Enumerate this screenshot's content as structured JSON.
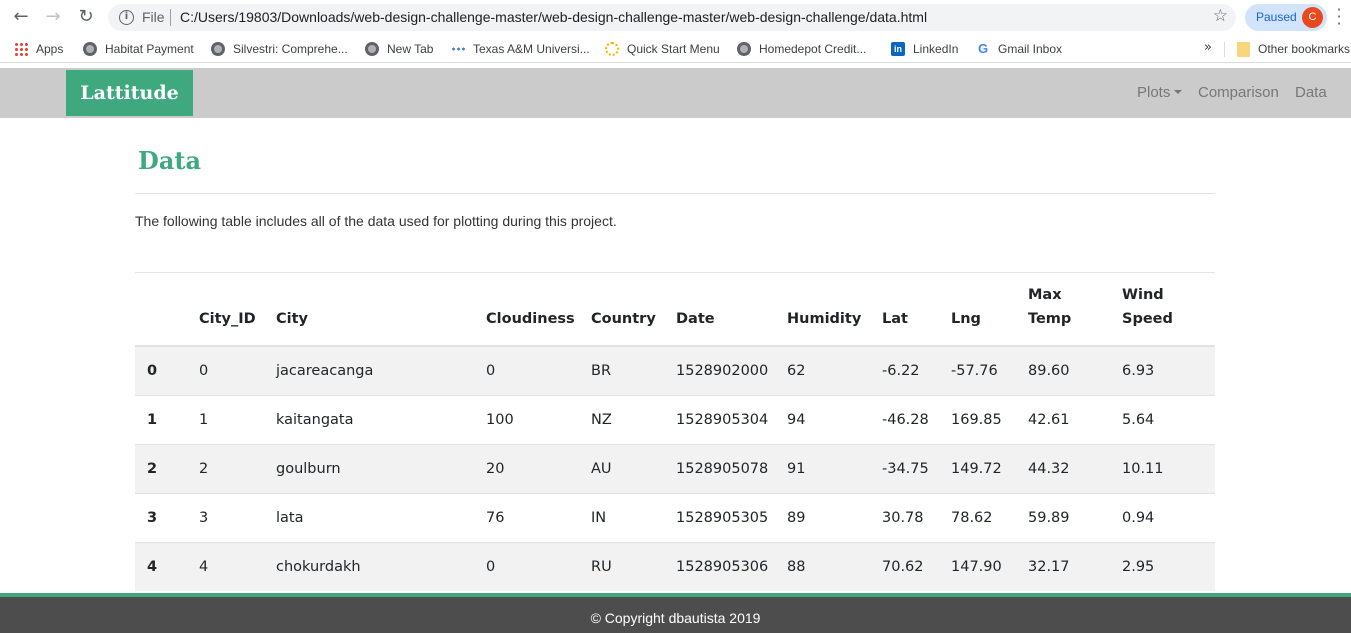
{
  "browser": {
    "file_label": "File",
    "url": "C:/Users/19803/Downloads/web-design-challenge-master/web-design-challenge-master/web-design-challenge/data.html",
    "profile_status": "Paused",
    "profile_initial": "C",
    "bookmarks": [
      {
        "label": "Apps",
        "icon": "apps-grid-icon"
      },
      {
        "label": "Habitat Payment",
        "icon": "globe-icon"
      },
      {
        "label": "Silvestri: Comprehe...",
        "icon": "globe-icon"
      },
      {
        "label": "New Tab",
        "icon": "globe-icon"
      },
      {
        "label": "Texas A&M Universi...",
        "icon": "tamu-icon"
      },
      {
        "label": "Quick Start Menu",
        "icon": "quick-start-icon"
      },
      {
        "label": "Homedepot Credit...",
        "icon": "globe-icon"
      },
      {
        "label": "LinkedIn",
        "icon": "linkedin-icon"
      },
      {
        "label": "Gmail Inbox",
        "icon": "google-icon"
      }
    ],
    "overflow_label": "»",
    "other_bookmarks": "Other bookmarks"
  },
  "site": {
    "brand": "Lattitude",
    "nav": {
      "plots": "Plots",
      "comparison": "Comparison",
      "data": "Data"
    }
  },
  "page": {
    "title": "Data",
    "intro": "The following table includes all of the data used for plotting during this project."
  },
  "table": {
    "headers": [
      "",
      "City_ID",
      "City",
      "Cloudiness",
      "Country",
      "Date",
      "Humidity",
      "Lat",
      "Lng",
      "Max Temp",
      "Wind Speed"
    ],
    "rows": [
      [
        "0",
        "0",
        "jacareacanga",
        "0",
        "BR",
        "1528902000",
        "62",
        "-6.22",
        "-57.76",
        "89.60",
        "6.93"
      ],
      [
        "1",
        "1",
        "kaitangata",
        "100",
        "NZ",
        "1528905304",
        "94",
        "-46.28",
        "169.85",
        "42.61",
        "5.64"
      ],
      [
        "2",
        "2",
        "goulburn",
        "20",
        "AU",
        "1528905078",
        "91",
        "-34.75",
        "149.72",
        "44.32",
        "10.11"
      ],
      [
        "3",
        "3",
        "lata",
        "76",
        "IN",
        "1528905305",
        "89",
        "30.78",
        "78.62",
        "59.89",
        "0.94"
      ],
      [
        "4",
        "4",
        "chokurdakh",
        "0",
        "RU",
        "1528905306",
        "88",
        "70.62",
        "147.90",
        "32.17",
        "2.95"
      ]
    ]
  },
  "footer": {
    "text": "© Copyright dbautista 2019"
  },
  "colors": {
    "accent": "#3fa87f",
    "navbar": "#cacbca",
    "footer": "#4d4d4d"
  }
}
